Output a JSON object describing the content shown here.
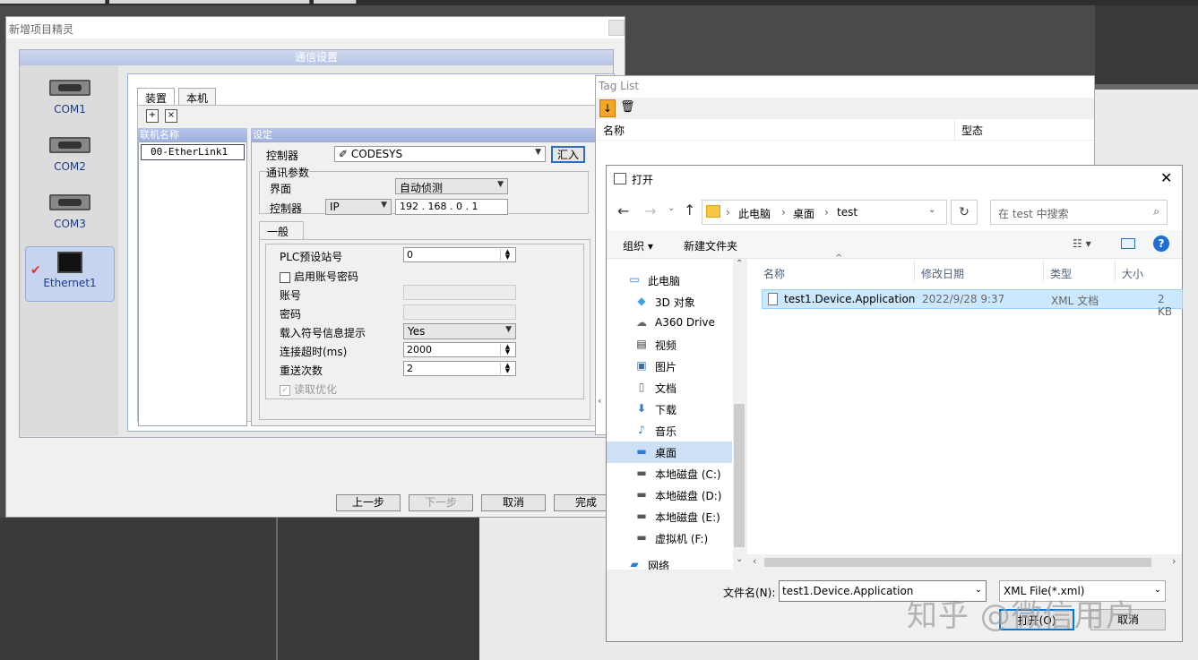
{
  "wizard": {
    "title": "新增项目精灵",
    "comm_header": "通信设置",
    "ports": [
      "COM1",
      "COM2",
      "COM3",
      "Ethernet1"
    ],
    "tabs": [
      "装置",
      "本机"
    ],
    "link_header": "联机名称",
    "link_item": "00-EtherLink1",
    "settings_header": "设定",
    "controller_label": "控制器",
    "controller_value": "CODESYS",
    "import_button": "汇入",
    "comm_params": "通讯参数",
    "interface_label": "界面",
    "interface_value": "自动侦测",
    "controller2_label": "控制器",
    "protocol_value": "IP",
    "ip_parts": [
      "192",
      "168",
      "0",
      "1"
    ],
    "general_tab": "一般",
    "plc_station_label": "PLC预设站号",
    "plc_station_value": "0",
    "enable_pwd_label": "启用账号密码",
    "account_label": "账号",
    "password_label": "密码",
    "symbol_hint_label": "载入符号信息提示",
    "symbol_hint_value": "Yes",
    "timeout_label": "连接超时(ms)",
    "timeout_value": "2000",
    "retry_label": "重送次数",
    "retry_value": "2",
    "read_opt_label": "读取优化",
    "buttons": {
      "prev": "上一步",
      "next": "下一步",
      "cancel": "取消",
      "finish": "完成"
    }
  },
  "taglist": {
    "title": "Tag List",
    "col_name": "名称",
    "col_type": "型态"
  },
  "open_dialog": {
    "title": "打开",
    "breadcrumb": [
      "此电脑",
      "桌面",
      "test"
    ],
    "search_placeholder": "在 test 中搜索",
    "organize": "组织 ▾",
    "new_folder": "新建文件夹",
    "tree": [
      {
        "label": "此电脑",
        "icon": "computer-icon"
      },
      {
        "label": "3D 对象",
        "icon": "cube-icon"
      },
      {
        "label": "A360 Drive",
        "icon": "cloud-drive-icon"
      },
      {
        "label": "视频",
        "icon": "video-icon"
      },
      {
        "label": "图片",
        "icon": "picture-icon"
      },
      {
        "label": "文档",
        "icon": "document-icon"
      },
      {
        "label": "下载",
        "icon": "download-icon"
      },
      {
        "label": "音乐",
        "icon": "music-icon"
      },
      {
        "label": "桌面",
        "icon": "desktop-icon"
      },
      {
        "label": "本地磁盘 (C:)",
        "icon": "disk-icon"
      },
      {
        "label": "本地磁盘 (D:)",
        "icon": "disk-icon"
      },
      {
        "label": "本地磁盘 (E:)",
        "icon": "disk-icon"
      },
      {
        "label": "虚拟机 (F:)",
        "icon": "disk-icon"
      },
      {
        "label": "网络",
        "icon": "network-icon"
      }
    ],
    "columns": [
      "名称",
      "修改日期",
      "类型",
      "大小"
    ],
    "file": {
      "name": "test1.Device.Application",
      "date": "2022/9/28 9:37",
      "type": "XML 文档",
      "size": "2 KB"
    },
    "filename_label": "文件名(N):",
    "filename_value": "test1.Device.Application",
    "filetype_value": "XML File(*.xml)",
    "open_button": "打开(O)",
    "cancel_button": "取消"
  },
  "watermark": "知乎 @微信用户"
}
